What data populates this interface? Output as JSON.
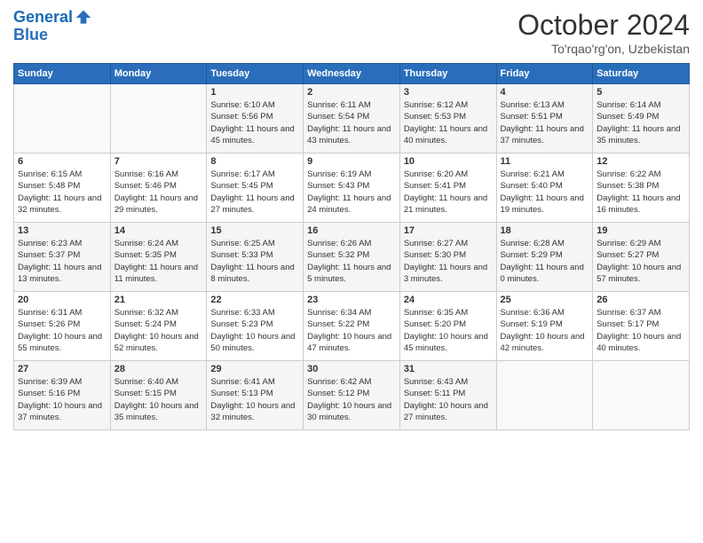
{
  "logo": {
    "line1": "General",
    "line2": "Blue"
  },
  "title": "October 2024",
  "location": "To'rqao'rg'on, Uzbekistan",
  "days_header": [
    "Sunday",
    "Monday",
    "Tuesday",
    "Wednesday",
    "Thursday",
    "Friday",
    "Saturday"
  ],
  "weeks": [
    [
      {
        "day": "",
        "sunrise": "",
        "sunset": "",
        "daylight": ""
      },
      {
        "day": "",
        "sunrise": "",
        "sunset": "",
        "daylight": ""
      },
      {
        "day": "1",
        "sunrise": "Sunrise: 6:10 AM",
        "sunset": "Sunset: 5:56 PM",
        "daylight": "Daylight: 11 hours and 45 minutes."
      },
      {
        "day": "2",
        "sunrise": "Sunrise: 6:11 AM",
        "sunset": "Sunset: 5:54 PM",
        "daylight": "Daylight: 11 hours and 43 minutes."
      },
      {
        "day": "3",
        "sunrise": "Sunrise: 6:12 AM",
        "sunset": "Sunset: 5:53 PM",
        "daylight": "Daylight: 11 hours and 40 minutes."
      },
      {
        "day": "4",
        "sunrise": "Sunrise: 6:13 AM",
        "sunset": "Sunset: 5:51 PM",
        "daylight": "Daylight: 11 hours and 37 minutes."
      },
      {
        "day": "5",
        "sunrise": "Sunrise: 6:14 AM",
        "sunset": "Sunset: 5:49 PM",
        "daylight": "Daylight: 11 hours and 35 minutes."
      }
    ],
    [
      {
        "day": "6",
        "sunrise": "Sunrise: 6:15 AM",
        "sunset": "Sunset: 5:48 PM",
        "daylight": "Daylight: 11 hours and 32 minutes."
      },
      {
        "day": "7",
        "sunrise": "Sunrise: 6:16 AM",
        "sunset": "Sunset: 5:46 PM",
        "daylight": "Daylight: 11 hours and 29 minutes."
      },
      {
        "day": "8",
        "sunrise": "Sunrise: 6:17 AM",
        "sunset": "Sunset: 5:45 PM",
        "daylight": "Daylight: 11 hours and 27 minutes."
      },
      {
        "day": "9",
        "sunrise": "Sunrise: 6:19 AM",
        "sunset": "Sunset: 5:43 PM",
        "daylight": "Daylight: 11 hours and 24 minutes."
      },
      {
        "day": "10",
        "sunrise": "Sunrise: 6:20 AM",
        "sunset": "Sunset: 5:41 PM",
        "daylight": "Daylight: 11 hours and 21 minutes."
      },
      {
        "day": "11",
        "sunrise": "Sunrise: 6:21 AM",
        "sunset": "Sunset: 5:40 PM",
        "daylight": "Daylight: 11 hours and 19 minutes."
      },
      {
        "day": "12",
        "sunrise": "Sunrise: 6:22 AM",
        "sunset": "Sunset: 5:38 PM",
        "daylight": "Daylight: 11 hours and 16 minutes."
      }
    ],
    [
      {
        "day": "13",
        "sunrise": "Sunrise: 6:23 AM",
        "sunset": "Sunset: 5:37 PM",
        "daylight": "Daylight: 11 hours and 13 minutes."
      },
      {
        "day": "14",
        "sunrise": "Sunrise: 6:24 AM",
        "sunset": "Sunset: 5:35 PM",
        "daylight": "Daylight: 11 hours and 11 minutes."
      },
      {
        "day": "15",
        "sunrise": "Sunrise: 6:25 AM",
        "sunset": "Sunset: 5:33 PM",
        "daylight": "Daylight: 11 hours and 8 minutes."
      },
      {
        "day": "16",
        "sunrise": "Sunrise: 6:26 AM",
        "sunset": "Sunset: 5:32 PM",
        "daylight": "Daylight: 11 hours and 5 minutes."
      },
      {
        "day": "17",
        "sunrise": "Sunrise: 6:27 AM",
        "sunset": "Sunset: 5:30 PM",
        "daylight": "Daylight: 11 hours and 3 minutes."
      },
      {
        "day": "18",
        "sunrise": "Sunrise: 6:28 AM",
        "sunset": "Sunset: 5:29 PM",
        "daylight": "Daylight: 11 hours and 0 minutes."
      },
      {
        "day": "19",
        "sunrise": "Sunrise: 6:29 AM",
        "sunset": "Sunset: 5:27 PM",
        "daylight": "Daylight: 10 hours and 57 minutes."
      }
    ],
    [
      {
        "day": "20",
        "sunrise": "Sunrise: 6:31 AM",
        "sunset": "Sunset: 5:26 PM",
        "daylight": "Daylight: 10 hours and 55 minutes."
      },
      {
        "day": "21",
        "sunrise": "Sunrise: 6:32 AM",
        "sunset": "Sunset: 5:24 PM",
        "daylight": "Daylight: 10 hours and 52 minutes."
      },
      {
        "day": "22",
        "sunrise": "Sunrise: 6:33 AM",
        "sunset": "Sunset: 5:23 PM",
        "daylight": "Daylight: 10 hours and 50 minutes."
      },
      {
        "day": "23",
        "sunrise": "Sunrise: 6:34 AM",
        "sunset": "Sunset: 5:22 PM",
        "daylight": "Daylight: 10 hours and 47 minutes."
      },
      {
        "day": "24",
        "sunrise": "Sunrise: 6:35 AM",
        "sunset": "Sunset: 5:20 PM",
        "daylight": "Daylight: 10 hours and 45 minutes."
      },
      {
        "day": "25",
        "sunrise": "Sunrise: 6:36 AM",
        "sunset": "Sunset: 5:19 PM",
        "daylight": "Daylight: 10 hours and 42 minutes."
      },
      {
        "day": "26",
        "sunrise": "Sunrise: 6:37 AM",
        "sunset": "Sunset: 5:17 PM",
        "daylight": "Daylight: 10 hours and 40 minutes."
      }
    ],
    [
      {
        "day": "27",
        "sunrise": "Sunrise: 6:39 AM",
        "sunset": "Sunset: 5:16 PM",
        "daylight": "Daylight: 10 hours and 37 minutes."
      },
      {
        "day": "28",
        "sunrise": "Sunrise: 6:40 AM",
        "sunset": "Sunset: 5:15 PM",
        "daylight": "Daylight: 10 hours and 35 minutes."
      },
      {
        "day": "29",
        "sunrise": "Sunrise: 6:41 AM",
        "sunset": "Sunset: 5:13 PM",
        "daylight": "Daylight: 10 hours and 32 minutes."
      },
      {
        "day": "30",
        "sunrise": "Sunrise: 6:42 AM",
        "sunset": "Sunset: 5:12 PM",
        "daylight": "Daylight: 10 hours and 30 minutes."
      },
      {
        "day": "31",
        "sunrise": "Sunrise: 6:43 AM",
        "sunset": "Sunset: 5:11 PM",
        "daylight": "Daylight: 10 hours and 27 minutes."
      },
      {
        "day": "",
        "sunrise": "",
        "sunset": "",
        "daylight": ""
      },
      {
        "day": "",
        "sunrise": "",
        "sunset": "",
        "daylight": ""
      }
    ]
  ]
}
